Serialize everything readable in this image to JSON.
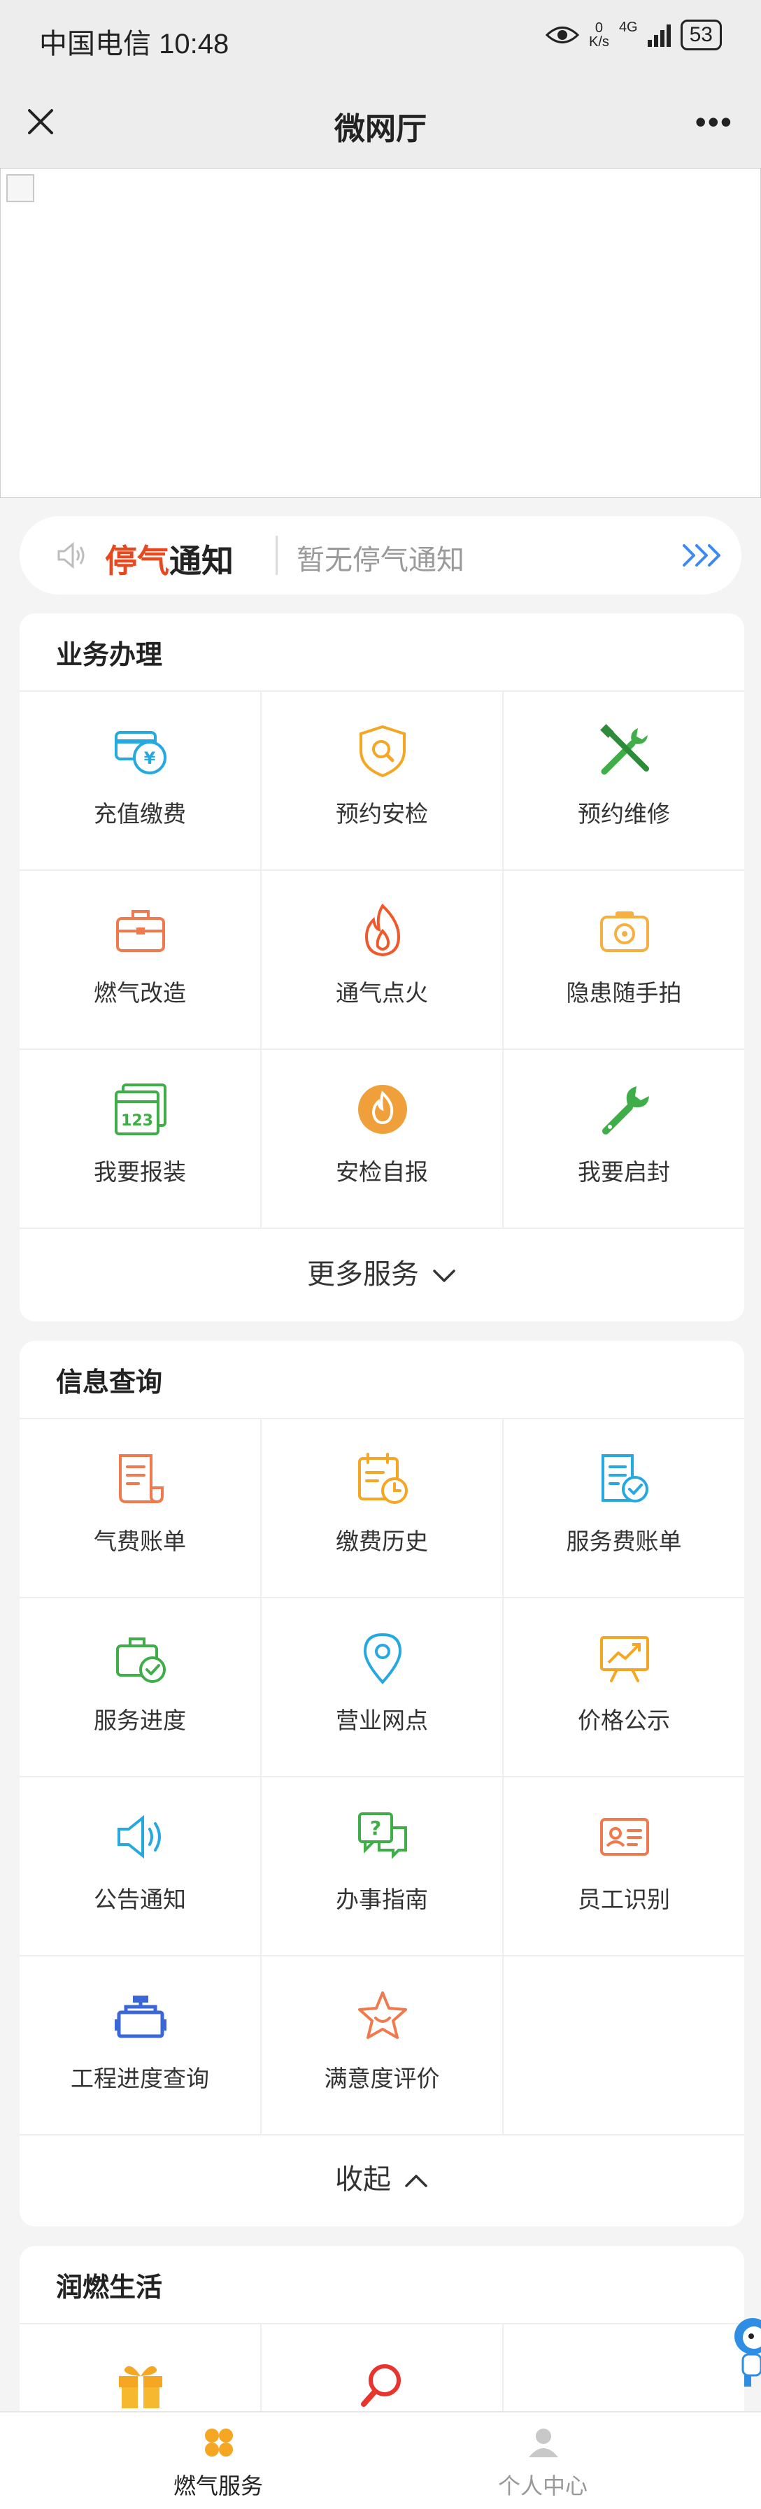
{
  "status_bar": {
    "carrier_time": "中国电信 10:48",
    "net_speed_value": "0",
    "net_speed_unit": "K/s",
    "network": "4G",
    "battery": "53"
  },
  "nav": {
    "title": "微网厅"
  },
  "notice": {
    "title_part1": "停气",
    "title_part2": "通知",
    "text": "暂无停气通知"
  },
  "business": {
    "title": "业务办理",
    "items": [
      {
        "label": "充值缴费"
      },
      {
        "label": "预约安检"
      },
      {
        "label": "预约维修"
      },
      {
        "label": "燃气改造"
      },
      {
        "label": "通气点火"
      },
      {
        "label": "隐患随手拍"
      },
      {
        "label": "我要报装"
      },
      {
        "label": "安检自报"
      },
      {
        "label": "我要启封"
      }
    ],
    "more_label": "更多服务"
  },
  "info": {
    "title": "信息查询",
    "items": [
      {
        "label": "气费账单"
      },
      {
        "label": "缴费历史"
      },
      {
        "label": "服务费账单"
      },
      {
        "label": "服务进度"
      },
      {
        "label": "营业网点"
      },
      {
        "label": "价格公示"
      },
      {
        "label": "公告通知"
      },
      {
        "label": "办事指南"
      },
      {
        "label": "员工识别"
      },
      {
        "label": "工程进度查询"
      },
      {
        "label": "满意度评价"
      }
    ],
    "collapse_label": "收起"
  },
  "life": {
    "title": "润燃生活"
  },
  "tabbar": {
    "gas_service": "燃气服务",
    "personal_center": "个人中心"
  },
  "colors": {
    "accent_orange": "#f5a623",
    "notice_red": "#e8481e",
    "arrow_blue": "#3d8bf2"
  }
}
